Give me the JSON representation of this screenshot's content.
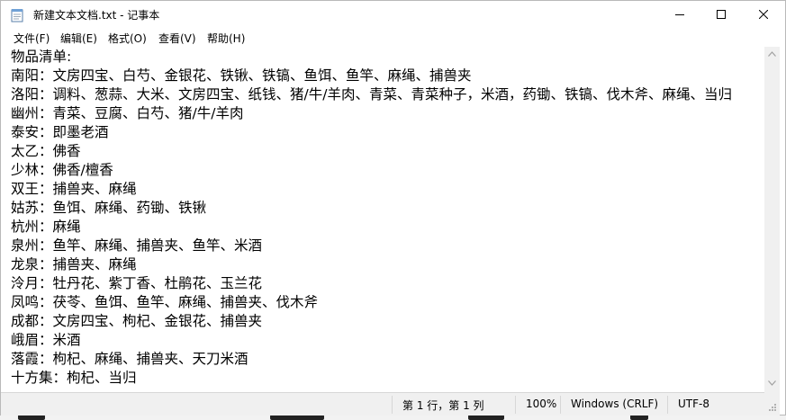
{
  "window": {
    "title": "新建文本文档.txt - 记事本"
  },
  "menu": [
    {
      "label": "文件(F)"
    },
    {
      "label": "编辑(E)"
    },
    {
      "label": "格式(O)"
    },
    {
      "label": "查看(V)"
    },
    {
      "label": "帮助(H)"
    }
  ],
  "document": {
    "lines": [
      "物品清单:",
      "南阳：文房四宝、白芍、金银花、铁锹、铁镐、鱼饵、鱼竿、麻绳、捕兽夹",
      "洛阳：调料、葱蒜、大米、文房四宝、纸钱、猪/牛/羊肉、青菜、青菜种子，米酒，药锄、铁镐、伐木斧、麻绳、当归",
      "幽州：青菜、豆腐、白芍、猪/牛/羊肉",
      "泰安：即墨老酒",
      "太乙：佛香",
      "少林：佛香/檀香",
      "双王：捕兽夹、麻绳",
      "姑苏：鱼饵、麻绳、药锄、铁锹",
      "杭州：麻绳",
      "泉州：鱼竿、麻绳、捕兽夹、鱼竿、米酒",
      "龙泉：捕兽夹、麻绳",
      "泠月：牡丹花、紫丁香、杜鹃花、玉兰花",
      "凤鸣：茯苓、鱼饵、鱼竿、麻绳、捕兽夹、伐木斧",
      "成都：文房四宝、枸杞、金银花、捕兽夹",
      "峨眉：米酒",
      "落霞：枸杞、麻绳、捕兽夹、天刀米酒",
      "十方集：枸杞、当归"
    ]
  },
  "status": {
    "position": "第 1 行，第 1 列",
    "zoom": "100%",
    "line_ending": "Windows (CRLF)",
    "encoding": "UTF-8"
  },
  "icons": {
    "app": "notepad-icon",
    "minimize": "minimize-icon",
    "maximize": "maximize-icon",
    "close": "close-icon"
  },
  "colors": {
    "window_bg": "#ffffff",
    "chrome_bg": "#f0f0f0",
    "text": "#000000"
  }
}
